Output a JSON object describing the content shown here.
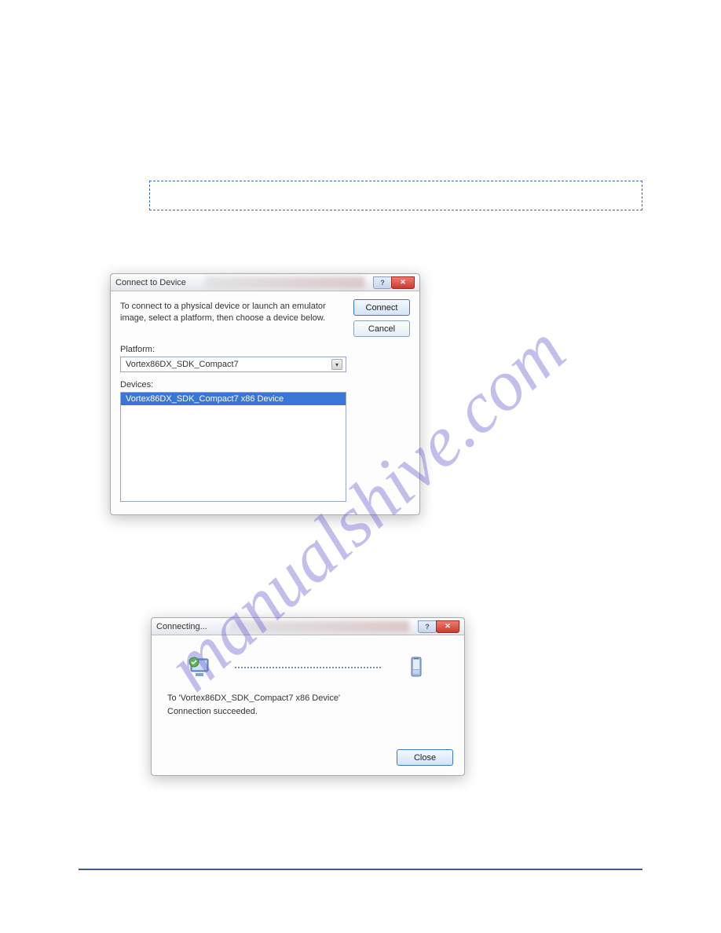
{
  "note": " ",
  "dialog1": {
    "title": "Connect to Device",
    "help_glyph": "?",
    "close_glyph": "✕",
    "instructions": "To connect to a physical device or launch an emulator image, select a platform, then choose a device below.",
    "connect_label": "Connect",
    "cancel_label": "Cancel",
    "platform_label": "Platform:",
    "platform_value": "Vortex86DX_SDK_Compact7",
    "devices_label": "Devices:",
    "device_item": "Vortex86DX_SDK_Compact7 x86 Device"
  },
  "dialog2": {
    "title": "Connecting...",
    "help_glyph": "?",
    "close_glyph": "✕",
    "to_line": "To 'Vortex86DX_SDK_Compact7 x86 Device'",
    "status_line": "Connection succeeded.",
    "close_label": "Close"
  },
  "watermark_text": "manualshive.com"
}
